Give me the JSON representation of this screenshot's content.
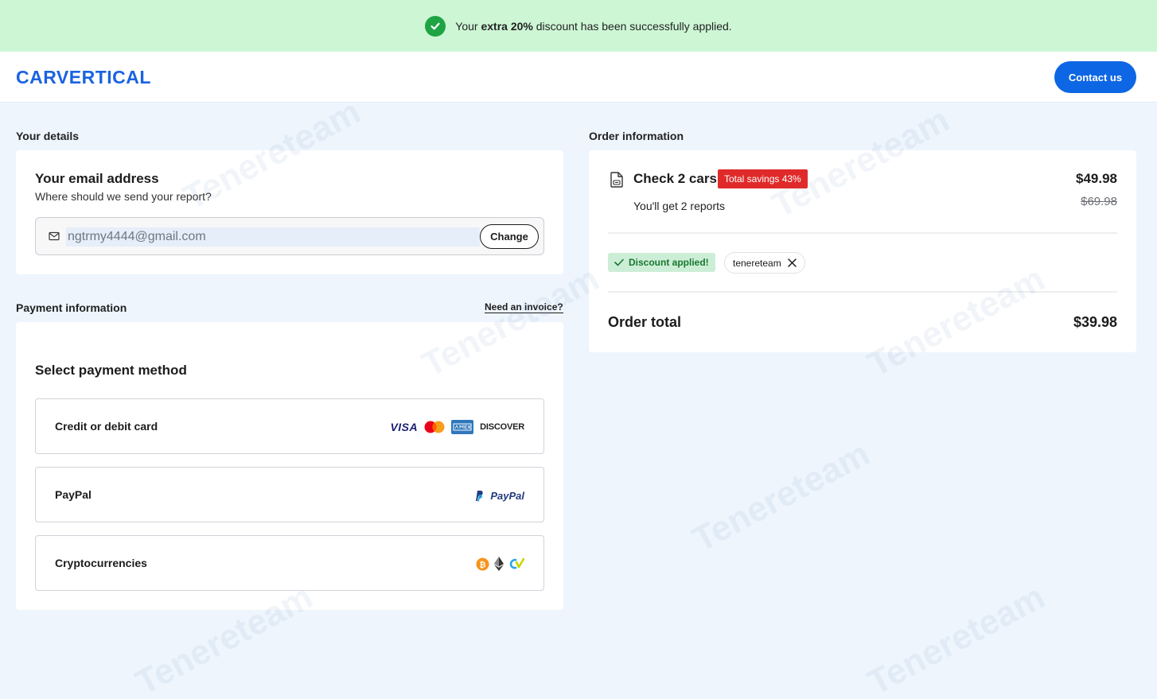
{
  "banner": {
    "text_before": "Your ",
    "text_bold": "extra 20%",
    "text_after": " discount has been successfully applied."
  },
  "header": {
    "logo_text": "CARVERTICAL",
    "contact_label": "Contact us"
  },
  "your_details": {
    "section_title": "Your details",
    "email_title": "Your email address",
    "email_subtitle": "Where should we send your report?",
    "email_value": "ngtrmy4444@gmail.com",
    "change_label": "Change"
  },
  "payment": {
    "section_title": "Payment information",
    "invoice_link": "Need an invoice?",
    "select_title": "Select payment method",
    "options": [
      {
        "label": "Credit or debit card",
        "logos": [
          "VISA",
          "mastercard-icon",
          "amex-icon",
          "DISCOVER"
        ]
      },
      {
        "label": "PayPal",
        "logos": [
          "PayPal"
        ]
      },
      {
        "label": "Cryptocurrencies",
        "logos": [
          "bitcoin-icon",
          "ethereum-icon",
          "crypto-icon"
        ]
      }
    ]
  },
  "order": {
    "section_title": "Order information",
    "product_name": "Check 2 cars",
    "savings_badge": "Total savings 43%",
    "product_sub": "You'll get 2 reports",
    "price_now": "$49.98",
    "price_old": "$69.98",
    "discount_tag": "Discount applied!",
    "discount_code": "tenereteam",
    "total_label": "Order total",
    "total_value": "$39.98"
  },
  "watermark_text": "Tenereteam",
  "colors": {
    "accent": "#0d66e4",
    "banner_bg": "#cdf6d5",
    "success": "#1fa444",
    "badge_red": "#e02a2a",
    "page_bg": "#eef5fd"
  }
}
